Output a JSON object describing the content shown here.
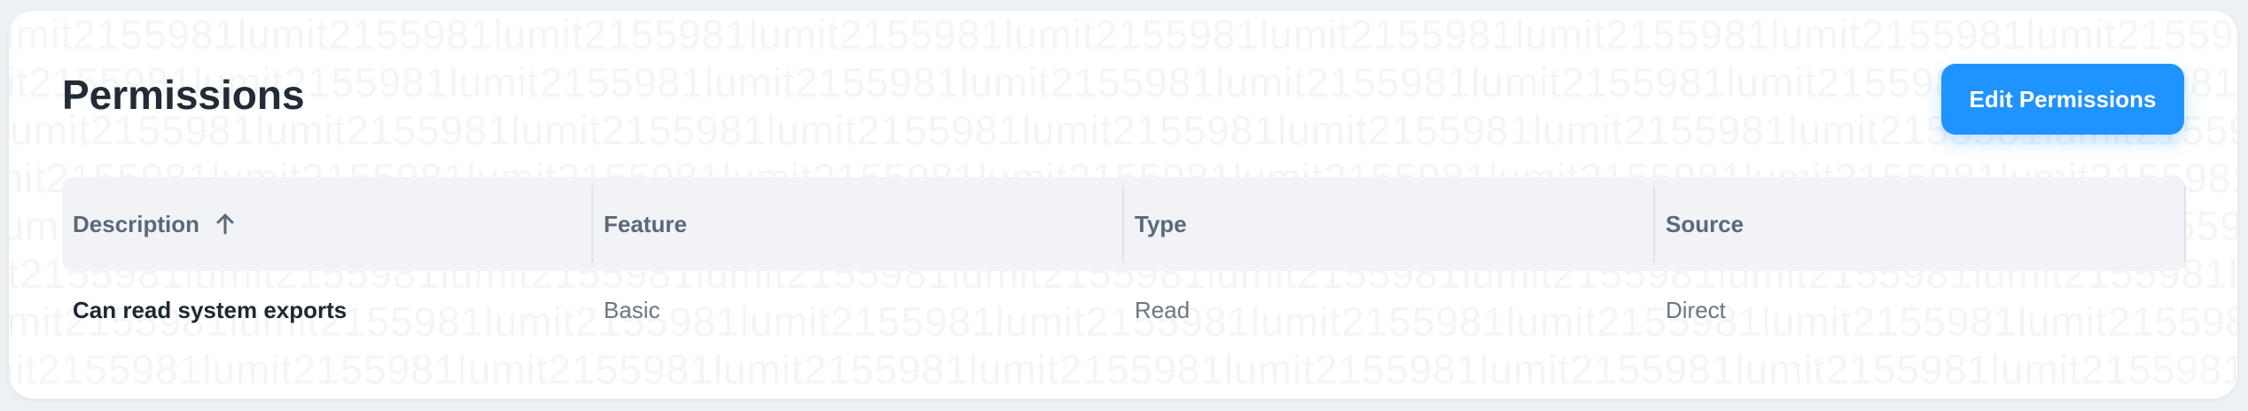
{
  "page": {
    "title": "Permissions",
    "edit_button_label": "Edit Permissions",
    "watermark_text": "lumit2155981"
  },
  "table": {
    "headers": [
      {
        "label": "Description",
        "sorted": "ascending",
        "sort_icon": "arrow-up-icon"
      },
      {
        "label": "Feature"
      },
      {
        "label": "Type"
      },
      {
        "label": "Source"
      }
    ],
    "rows": [
      {
        "description": "Can read system exports",
        "feature": "Basic",
        "type": "Read",
        "source": "Direct"
      }
    ]
  },
  "colors": {
    "accent": "#1f93ff",
    "title_text": "#222b36",
    "header_bg": "#f0f2f6",
    "header_text": "#5b6878",
    "body_text": "#6b7683"
  }
}
